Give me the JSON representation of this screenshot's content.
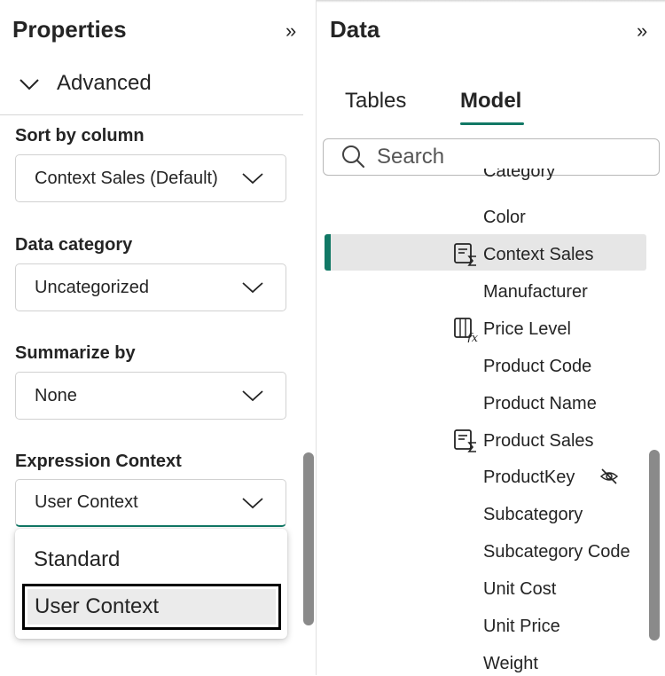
{
  "properties": {
    "title": "Properties",
    "section": "Advanced",
    "fields": [
      {
        "label": "Sort by column",
        "value": "Context Sales (Default)"
      },
      {
        "label": "Data category",
        "value": "Uncategorized"
      },
      {
        "label": "Summarize by",
        "value": "None"
      },
      {
        "label": "Expression Context",
        "value": "User Context"
      }
    ],
    "menu": {
      "options": [
        "Standard",
        "User Context"
      ],
      "selected": "User Context"
    }
  },
  "data_pane": {
    "title": "Data",
    "tabs": [
      {
        "label": "Tables",
        "active": false
      },
      {
        "label": "Model",
        "active": true
      }
    ],
    "search": {
      "placeholder": "Search"
    },
    "partial_item": "Category",
    "items": [
      {
        "label": "Color",
        "icon": ""
      },
      {
        "label": "Context Sales",
        "icon": "calculated-measure-icon",
        "selected": true
      },
      {
        "label": "Manufacturer",
        "icon": ""
      },
      {
        "label": "Price Level",
        "icon": "calculated-column-icon"
      },
      {
        "label": "Product Code",
        "icon": ""
      },
      {
        "label": "Product Name",
        "icon": ""
      },
      {
        "label": "Product Sales",
        "icon": "calculated-measure-icon"
      },
      {
        "label": "ProductKey",
        "icon": "hidden-eye-icon"
      },
      {
        "label": "Subcategory",
        "icon": ""
      },
      {
        "label": "Subcategory Code",
        "icon": ""
      },
      {
        "label": "Unit Cost",
        "icon": ""
      },
      {
        "label": "Unit Price",
        "icon": ""
      },
      {
        "label": "Weight",
        "icon": ""
      }
    ]
  },
  "colors": {
    "accent": "#117865",
    "scrollbar": "#8a8a8a",
    "selected_row": "#e6e6e6"
  }
}
